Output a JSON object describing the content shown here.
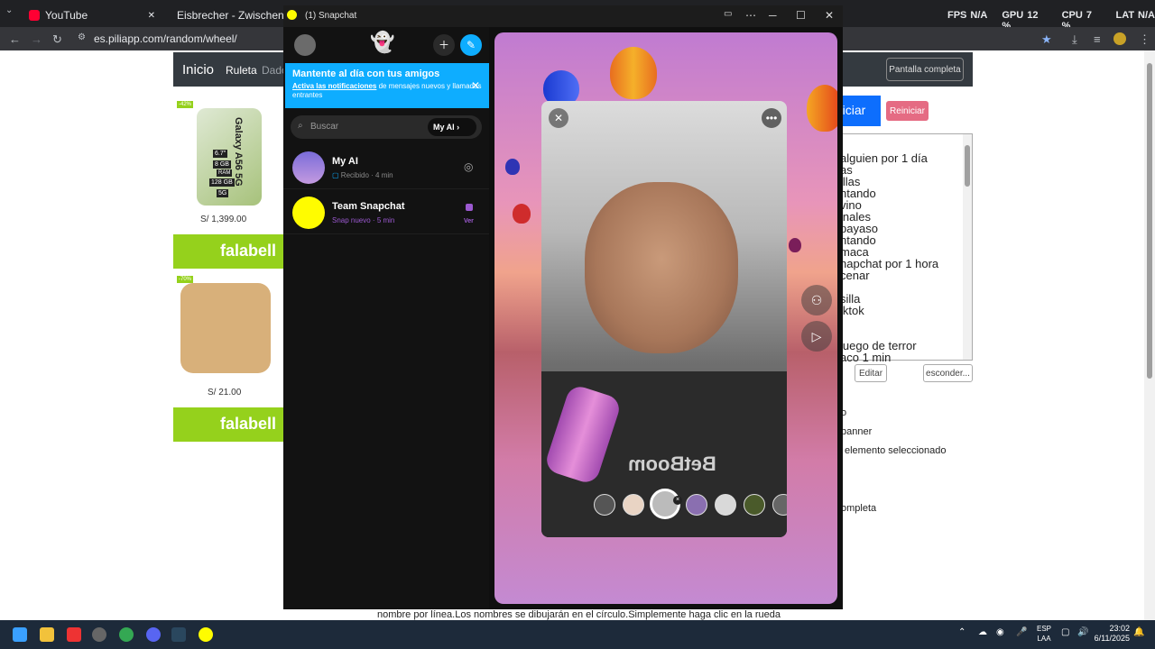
{
  "browser": {
    "tabs": [
      {
        "title": "YouTube"
      },
      {
        "title": "Eisbrecher - Zwischen uns"
      }
    ],
    "url": "es.piliapp.com/random/wheel/",
    "overlay": {
      "fps_label": "FPS",
      "fps_value": "N/A",
      "gpu_label": "GPU",
      "gpu_value": "12 %",
      "cpu_label": "CPU",
      "cpu_value": "7 %",
      "lat_label": "LAT",
      "lat_value": "N/A"
    }
  },
  "site": {
    "nav": {
      "brand": "Inicio",
      "link1": "Ruleta",
      "link2": "Dado",
      "fullscreen": "Pantalla completa"
    },
    "ads": [
      {
        "price": "S/ 1,399.00",
        "banner": "falabell",
        "badge": "-42%"
      },
      {
        "price": "S/ 21.00",
        "banner": "falabell",
        "badge": "-70%"
      }
    ],
    "phone_labels": [
      "6.7\"",
      "8 GB",
      "RAM",
      "128 GB",
      "5G",
      "Galaxy A56 5G"
    ],
    "buttons": {
      "start": "Iniciar",
      "reset": "Reiniciar",
      "edit": "Editar",
      "hide": "esconder..."
    },
    "names": [
      "alguien por 1 día",
      "as",
      "illas",
      "ntando",
      "vino",
      "inales",
      " payaso",
      "ntando",
      "maca",
      "napchat por 1 hora",
      " cenar",
      "",
      " silla",
      "iktok",
      "",
      "",
      " juego de terror",
      "aco 1 min"
    ],
    "options": [
      "o",
      "banner",
      "elemento seleccionado",
      "ompleta"
    ],
    "instructions": "nombre por línea.Los nombres se dibujarán en el círculo.Simplemente haga clic en la rueda"
  },
  "snapchat": {
    "window_title": "(1) Snapchat",
    "notification": {
      "title": "Mantente al día con tus amigos",
      "link": "Activa las notificaciones",
      "body": " de mensajes nuevos y llamadas entrantes"
    },
    "search": {
      "placeholder": "Buscar",
      "my_ai": "My AI"
    },
    "chats": [
      {
        "name": "My AI",
        "status": "Recibido",
        "time": "4 min"
      },
      {
        "name": "Team Snapchat",
        "status": "Snap nuevo",
        "time": "5 min",
        "action": "Ver"
      }
    ],
    "snap_shirt_text": "BetBoom"
  },
  "taskbar": {
    "lang": "ESP",
    "lang2": "LAA",
    "time": "23:02",
    "date": "6/11/2025"
  },
  "colors": {
    "snap_yellow": "#fffc00",
    "snap_blue": "#0eadff",
    "falabella_green": "#95d11c",
    "primary_blue": "#0d6efd",
    "reset_pink": "#e56b83"
  }
}
